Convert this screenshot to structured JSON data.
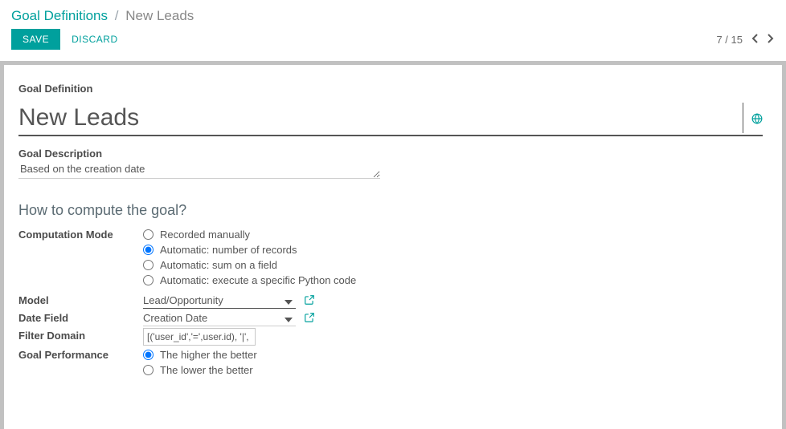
{
  "breadcrumb": {
    "root": "Goal Definitions",
    "sep": "/",
    "leaf": "New Leads"
  },
  "buttons": {
    "save": "SAVE",
    "discard": "DISCARD"
  },
  "pager": {
    "text": "7 / 15"
  },
  "form": {
    "definition_label": "Goal Definition",
    "name_value": "New Leads",
    "description_label": "Goal Description",
    "description_value": "Based on the creation date",
    "howto_heading": "How to compute the goal?",
    "computation_mode_label": "Computation Mode",
    "computation_modes": {
      "manual": "Recorded manually",
      "count": "Automatic: number of records",
      "sum": "Automatic: sum on a field",
      "python": "Automatic: execute a specific Python code",
      "selected": "count"
    },
    "model_label": "Model",
    "model_value": "Lead/Opportunity",
    "date_field_label": "Date Field",
    "date_field_value": "Creation Date",
    "filter_domain_label": "Filter Domain",
    "filter_domain_value": "[('user_id','=',user.id), '|', ('t",
    "goal_perf_label": "Goal Performance",
    "goal_perf": {
      "higher": "The higher the better",
      "lower": "The lower the better",
      "selected": "higher"
    }
  }
}
